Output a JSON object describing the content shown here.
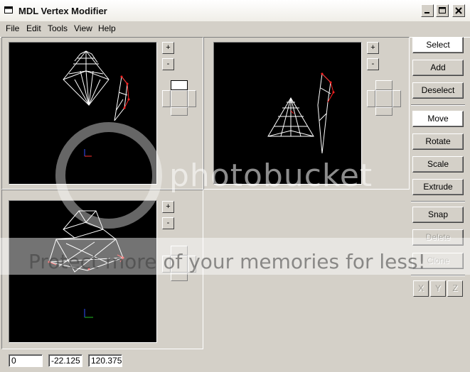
{
  "window": {
    "title": "MDL Vertex Modifier"
  },
  "menu": {
    "items": [
      "File",
      "Edit",
      "Tools",
      "View",
      "Help"
    ]
  },
  "viewports": {
    "zoom_in_label": "+",
    "zoom_out_label": "-"
  },
  "tools": {
    "select": "Select",
    "add": "Add",
    "deselect": "Deselect",
    "move": "Move",
    "rotate": "Rotate",
    "scale": "Scale",
    "extrude": "Extrude",
    "snap": "Snap",
    "delete": "Delete",
    "clone": "Clone",
    "axis_x": "X",
    "axis_y": "Y",
    "axis_z": "Z"
  },
  "status": {
    "x": "0",
    "y": "-22.125",
    "z": "120.375"
  },
  "watermark": {
    "brand": "photobucket",
    "tagline": "Protect more of your memories for less!"
  },
  "colors": {
    "viewport_bg": "#000000",
    "mesh": "#ffffff",
    "selected": "#ff2020",
    "face": "#d4d0c8"
  }
}
